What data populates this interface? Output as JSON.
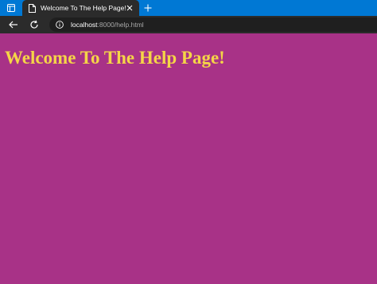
{
  "browser": {
    "tab": {
      "title": "Welcome To The Help Page!"
    },
    "address": {
      "host": "localhost",
      "rest": ":8000/help.html"
    },
    "colors": {
      "tabbar": "#0078d4",
      "toolbar": "#2b2b2b",
      "addressbar": "#1f1f1f"
    },
    "icons": [
      "tab-actions-icon",
      "page-icon",
      "close-icon",
      "plus-icon",
      "back-arrow-icon",
      "refresh-icon",
      "info-icon"
    ]
  },
  "page": {
    "heading": "Welcome To The Help Page!",
    "colors": {
      "background": "#a83287",
      "heading": "#f5d547"
    }
  }
}
